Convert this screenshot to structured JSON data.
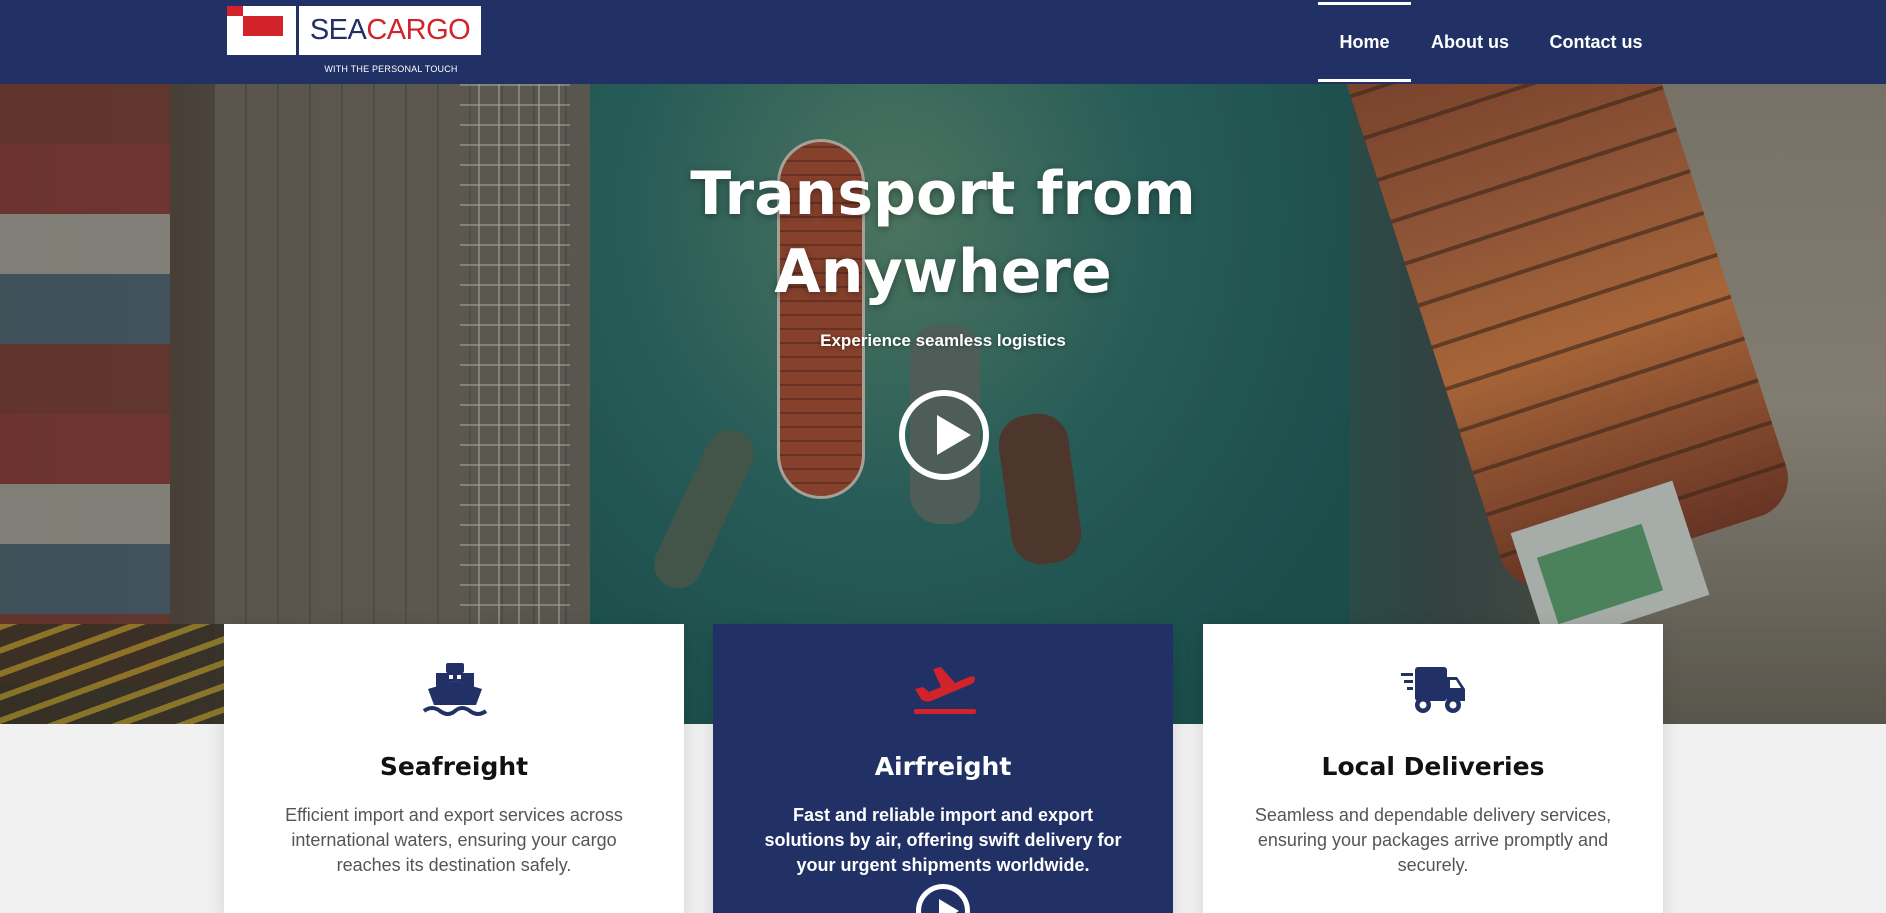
{
  "header": {
    "logo": {
      "sea": "SEA",
      "cargo": "CARGO",
      "tagline": "WITH THE PERSONAL TOUCH"
    },
    "nav": {
      "items": [
        {
          "label": "Home",
          "active": true
        },
        {
          "label": "About us",
          "active": false
        },
        {
          "label": "Contact us",
          "active": false
        }
      ]
    }
  },
  "hero": {
    "title": "Transport from Anywhere",
    "subtitle": "Experience seamless logistics",
    "play_icon": "play-circle-icon"
  },
  "services": [
    {
      "icon": "ship-icon",
      "title": "Seafreight",
      "text": "Efficient import and export services across international waters, ensuring your cargo reaches its destination safely."
    },
    {
      "icon": "airplane-icon",
      "title": "Airfreight",
      "text": "Fast and reliable import and export solutions by air, offering swift delivery for your urgent shipments worldwide.",
      "highlighted": true
    },
    {
      "icon": "truck-icon",
      "title": "Local Deliveries",
      "text": "Seamless and dependable delivery services, ensuring your packages arrive promptly and securely."
    }
  ],
  "colors": {
    "navy": "#213166",
    "red": "#d2232a",
    "white": "#ffffff",
    "body_text": "#555555"
  }
}
